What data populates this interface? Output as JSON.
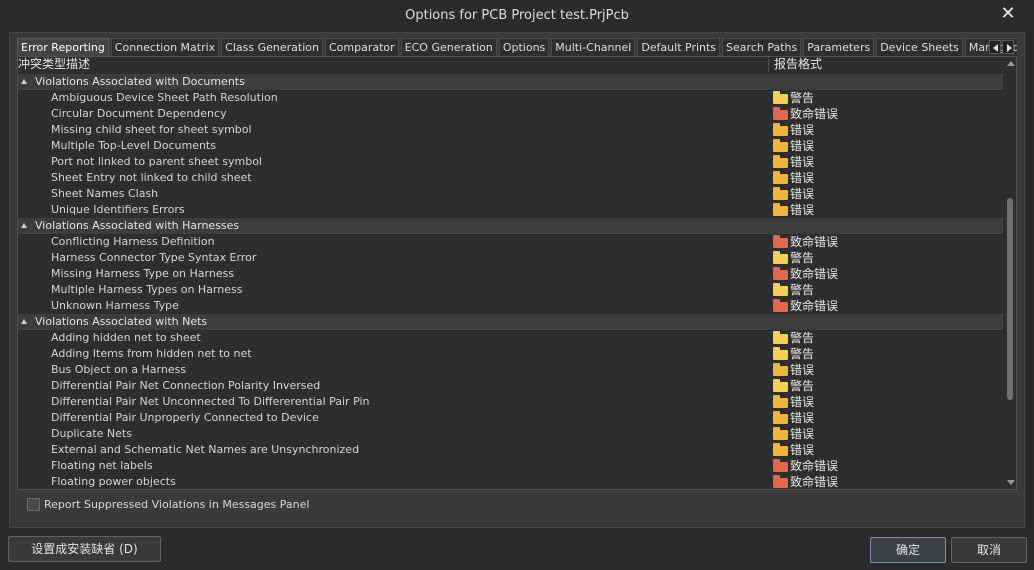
{
  "window": {
    "title": "Options for PCB Project test.PrjPcb",
    "close_symbol": "✕"
  },
  "tabs": [
    {
      "label": "Error Reporting",
      "active": true
    },
    {
      "label": "Connection Matrix",
      "active": false
    },
    {
      "label": "Class Generation",
      "active": false
    },
    {
      "label": "Comparator",
      "active": false
    },
    {
      "label": "ECO Generation",
      "active": false
    },
    {
      "label": "Options",
      "active": false
    },
    {
      "label": "Multi-Channel",
      "active": false
    },
    {
      "label": "Default Prints",
      "active": false
    },
    {
      "label": "Search Paths",
      "active": false
    },
    {
      "label": "Parameters",
      "active": false
    },
    {
      "label": "Device Sheets",
      "active": false
    },
    {
      "label": "Managed",
      "active": false
    }
  ],
  "columns": {
    "description": "冲突类型描述",
    "report_mode": "报告格式"
  },
  "groups": [
    {
      "label": "Violations Associated with Documents",
      "items": [
        {
          "name": "Ambiguous Device Sheet Path Resolution",
          "level": "警告",
          "kind": "warn"
        },
        {
          "name": "Circular Document Dependency",
          "level": "致命错误",
          "kind": "fatal"
        },
        {
          "name": "Missing child sheet for sheet symbol",
          "level": "错误",
          "kind": "error"
        },
        {
          "name": "Multiple Top-Level Documents",
          "level": "错误",
          "kind": "error"
        },
        {
          "name": "Port not linked to parent sheet symbol",
          "level": "错误",
          "kind": "error"
        },
        {
          "name": "Sheet Entry not linked to child sheet",
          "level": "错误",
          "kind": "error"
        },
        {
          "name": "Sheet Names Clash",
          "level": "错误",
          "kind": "error"
        },
        {
          "name": "Unique Identifiers Errors",
          "level": "错误",
          "kind": "error"
        }
      ]
    },
    {
      "label": "Violations Associated with Harnesses",
      "items": [
        {
          "name": "Conflicting Harness Definition",
          "level": "致命错误",
          "kind": "fatal"
        },
        {
          "name": "Harness Connector Type Syntax Error",
          "level": "警告",
          "kind": "warn"
        },
        {
          "name": "Missing Harness Type on Harness",
          "level": "致命错误",
          "kind": "fatal"
        },
        {
          "name": "Multiple Harness Types on Harness",
          "level": "警告",
          "kind": "warn"
        },
        {
          "name": "Unknown Harness Type",
          "level": "致命错误",
          "kind": "fatal"
        }
      ]
    },
    {
      "label": "Violations Associated with Nets",
      "items": [
        {
          "name": "Adding hidden net to sheet",
          "level": "警告",
          "kind": "warn"
        },
        {
          "name": "Adding Items from hidden net to net",
          "level": "警告",
          "kind": "warn"
        },
        {
          "name": "Bus Object on a Harness",
          "level": "错误",
          "kind": "error"
        },
        {
          "name": "Differential Pair Net Connection Polarity Inversed",
          "level": "警告",
          "kind": "warn"
        },
        {
          "name": "Differential Pair Net Unconnected To Differerential Pair Pin",
          "level": "错误",
          "kind": "error"
        },
        {
          "name": "Differential Pair Unproperly Connected to Device",
          "level": "错误",
          "kind": "error"
        },
        {
          "name": "Duplicate Nets",
          "level": "错误",
          "kind": "error"
        },
        {
          "name": "External and Schematic Net Names are Unsynchronized",
          "level": "错误",
          "kind": "error"
        },
        {
          "name": "Floating net labels",
          "level": "致命错误",
          "kind": "fatal"
        },
        {
          "name": "Floating power objects",
          "level": "致命错误",
          "kind": "fatal"
        }
      ]
    }
  ],
  "colors": {
    "warn": "#f6cf57",
    "error": "#f0b53b",
    "fatal": "#e2674a"
  },
  "icons": {
    "warn": "folder-icon",
    "error": "folder-icon",
    "fatal": "folder-icon",
    "expander": "collapse-triangle-icon"
  },
  "checkbox": {
    "label": "Report Suppressed Violations in Messages Panel",
    "checked": false
  },
  "buttons": {
    "defaults": "设置成安装缺省 (D)",
    "ok": "确定",
    "cancel": "取消"
  }
}
